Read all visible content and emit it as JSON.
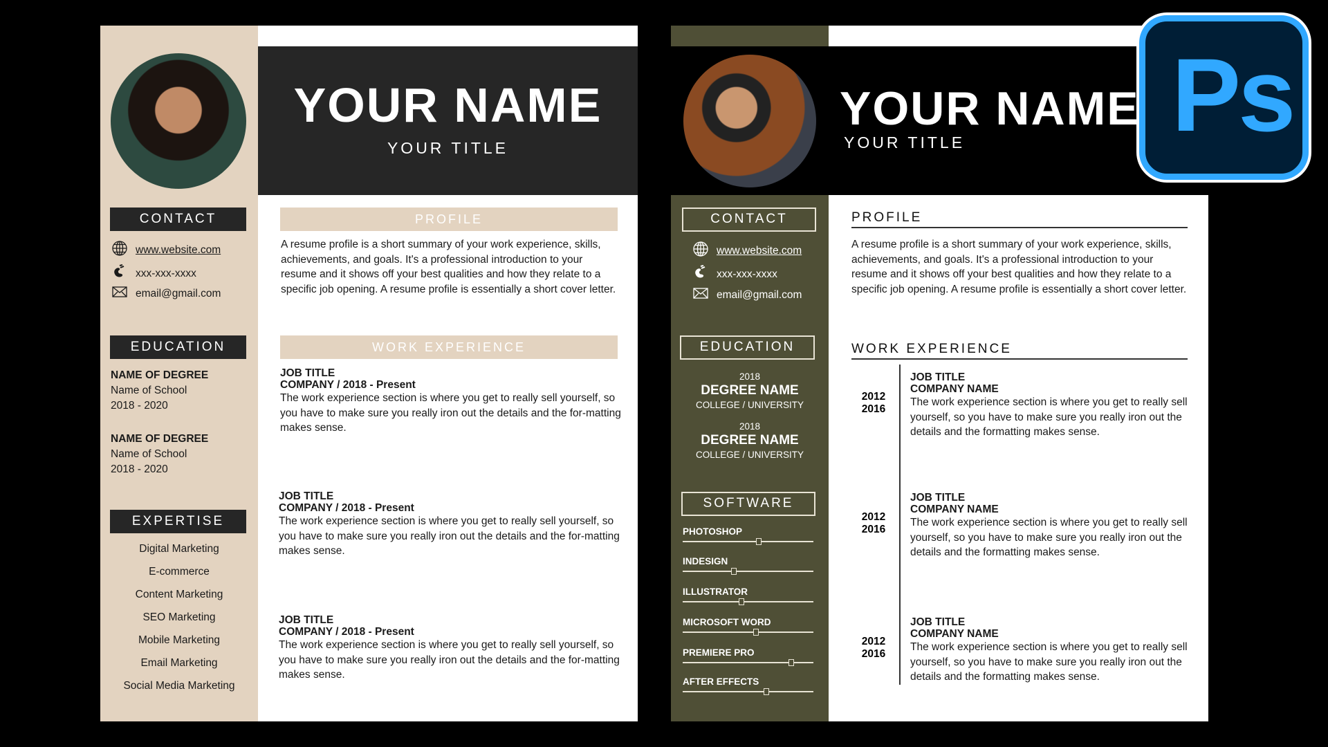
{
  "colors": {
    "beige": "#e3d3c0",
    "dark": "#262626",
    "olive": "#4f4f36",
    "ps_blue": "#31a8ff",
    "ps_bg": "#001e36"
  },
  "left": {
    "name": "YOUR NAME",
    "title": "YOUR TITLE",
    "contact_heading": "CONTACT",
    "contact": [
      {
        "icon": "globe-icon",
        "text": "www.website.com"
      },
      {
        "icon": "phone-icon",
        "text": "xxx-xxx-xxxx"
      },
      {
        "icon": "mail-icon",
        "text": "email@gmail.com"
      }
    ],
    "education_heading": "EDUCATION",
    "education": [
      {
        "degree": "NAME OF DEGREE",
        "school": "Name of School",
        "years": "2018 - 2020"
      },
      {
        "degree": "NAME OF DEGREE",
        "school": "Name of School",
        "years": "2018 - 2020"
      }
    ],
    "expertise_heading": "EXPERTISE",
    "expertise": [
      "Digital Marketing",
      "E-commerce",
      "Content Marketing",
      "SEO Marketing",
      "Mobile Marketing",
      "Email Marketing",
      "Social Media Marketing"
    ],
    "profile_heading": "PROFILE",
    "profile": "A resume profile is a short summary of your work experience, skills, achievements, and goals. It's a professional introduction to your resume and it shows off your best qualities and how they relate to a specific job opening. A resume profile is essentially a short cover letter.",
    "work_heading": "WORK EXPERIENCE",
    "jobs": [
      {
        "title": "JOB TITLE",
        "company": "COMPANY / 2018 - Present",
        "desc": "The work experience section is where you get to really sell yourself, so you have to make sure you really iron out the details and the for-matting makes sense."
      },
      {
        "title": "JOB TITLE",
        "company": "COMPANY / 2018 - Present",
        "desc": "The work experience section is where you get to really sell yourself, so you have to make sure you really iron out the details and the for-matting makes sense."
      },
      {
        "title": "JOB TITLE",
        "company": "COMPANY / 2018 - Present",
        "desc": "The work experience section is where you get to really sell yourself, so you have to make sure you really iron out the details and the for-matting makes sense."
      }
    ]
  },
  "right": {
    "name": "YOUR NAME",
    "title": "YOUR TITLE",
    "contact_heading": "CONTACT",
    "contact": [
      {
        "icon": "globe-icon",
        "text": "www.website.com"
      },
      {
        "icon": "phone-icon",
        "text": "xxx-xxx-xxxx"
      },
      {
        "icon": "mail-icon",
        "text": "email@gmail.com"
      }
    ],
    "education_heading": "EDUCATION",
    "education": [
      {
        "year": "2018",
        "degree": "DEGREE NAME",
        "school": "COLLEGE / UNIVERSITY"
      },
      {
        "year": "2018",
        "degree": "DEGREE NAME",
        "school": "COLLEGE / UNIVERSITY"
      }
    ],
    "software_heading": "SOFTWARE",
    "software": [
      {
        "name": "PHOTOSHOP",
        "level": 0.58
      },
      {
        "name": "INDESIGN",
        "level": 0.39
      },
      {
        "name": "ILLUSTRATOR",
        "level": 0.45
      },
      {
        "name": "MICROSOFT WORD",
        "level": 0.56
      },
      {
        "name": "PREMIERE PRO",
        "level": 0.83
      },
      {
        "name": "AFTER EFFECTS",
        "level": 0.64
      }
    ],
    "profile_heading": "PROFILE",
    "profile": "A resume profile is a short summary of your work experience, skills, achievements, and goals. It's a professional introduction to your resume and it shows off your best qualities and how they relate to a specific job opening. A resume profile is essentially a short cover letter.",
    "work_heading": "WORK EXPERIENCE",
    "jobs": [
      {
        "start": "2012",
        "end": "2016",
        "title": "JOB TITLE",
        "company": "COMPANY NAME",
        "desc": "The work experience section is where you get to really sell yourself, so you have to make sure you really iron out the details and the formatting makes sense."
      },
      {
        "start": "2012",
        "end": "2016",
        "title": "JOB TITLE",
        "company": "COMPANY NAME",
        "desc": "The work experience section is where you get to really sell yourself, so you have to make sure you really iron out the details and the formatting makes sense."
      },
      {
        "start": "2012",
        "end": "2016",
        "title": "JOB TITLE",
        "company": "COMPANY NAME",
        "desc": "The work experience section is where you get to really sell yourself, so you have to make sure you really iron out the details and the formatting makes sense."
      }
    ]
  },
  "logo": {
    "text": "Ps"
  }
}
